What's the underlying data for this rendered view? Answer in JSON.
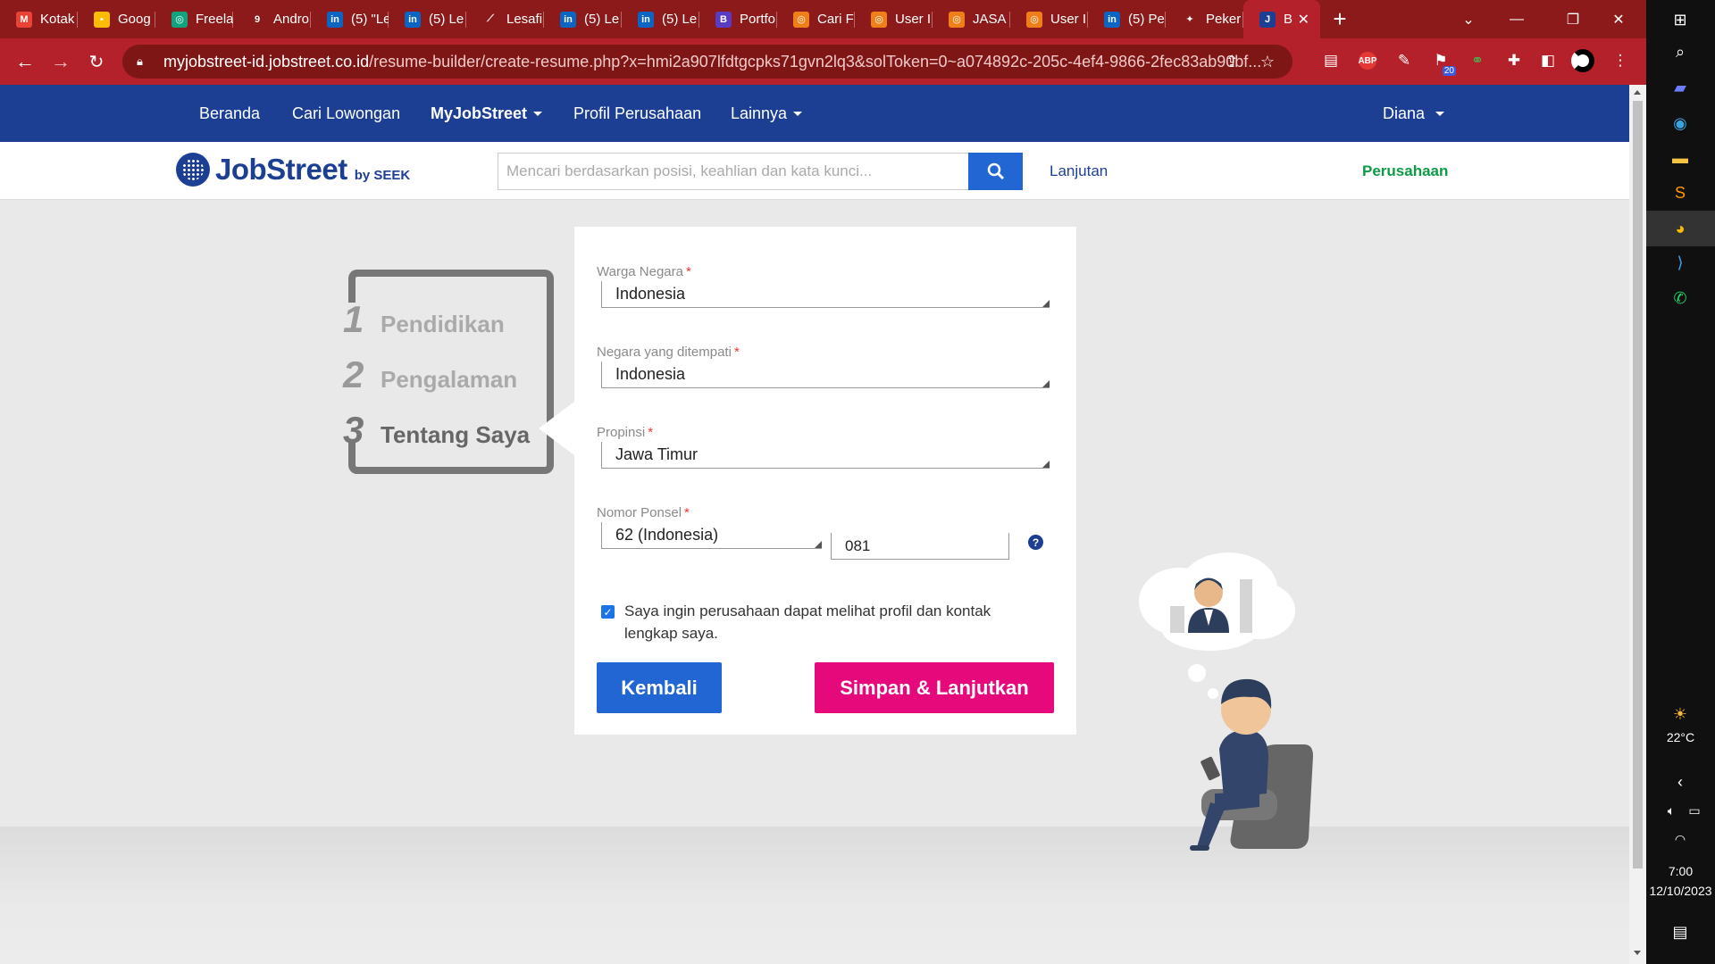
{
  "browser": {
    "tabs": [
      {
        "title": "Kotak",
        "icon": "gmail-icon",
        "color": "#ea4335",
        "glyph": "M"
      },
      {
        "title": "Goog",
        "icon": "google-keep-icon",
        "color": "#fbbc04",
        "glyph": "▪"
      },
      {
        "title": "Freela",
        "icon": "chatgpt-icon",
        "color": "#10a37f",
        "glyph": "◎"
      },
      {
        "title": "Andro",
        "icon": "g-icon",
        "color": "#8c1a1a",
        "glyph": "9"
      },
      {
        "title": "(5) \"Le",
        "icon": "linkedin-icon",
        "color": "#0a66c2",
        "glyph": "in"
      },
      {
        "title": "(5) Le",
        "icon": "linkedin-icon",
        "color": "#0a66c2",
        "glyph": "in"
      },
      {
        "title": "Lesafi",
        "icon": "chart-icon",
        "color": "#8c1a1a",
        "glyph": "⟋"
      },
      {
        "title": "(5) Le",
        "icon": "linkedin-icon",
        "color": "#0a66c2",
        "glyph": "in"
      },
      {
        "title": "(5) Le",
        "icon": "linkedin-icon",
        "color": "#0a66c2",
        "glyph": "in"
      },
      {
        "title": "Portfo",
        "icon": "behance-icon",
        "color": "#5a3cc4",
        "glyph": "B"
      },
      {
        "title": "Cari F",
        "icon": "freelancer-icon",
        "color": "#f07f1a",
        "glyph": "◎"
      },
      {
        "title": "User I",
        "icon": "freelancer-icon",
        "color": "#f07f1a",
        "glyph": "◎"
      },
      {
        "title": "JASA",
        "icon": "freelancer-icon",
        "color": "#f07f1a",
        "glyph": "◎"
      },
      {
        "title": "User I",
        "icon": "freelancer-icon",
        "color": "#f07f1a",
        "glyph": "◎"
      },
      {
        "title": "(5) Pe",
        "icon": "linkedin-icon",
        "color": "#0a66c2",
        "glyph": "in"
      },
      {
        "title": "Peker",
        "icon": "star-icon",
        "color": "#8c1a1a",
        "glyph": "✦"
      },
      {
        "title": "B",
        "icon": "jobstreet-icon",
        "color": "#1c3f94",
        "glyph": "J",
        "active": true
      }
    ],
    "url_host": "myjobstreet-id.jobstreet.co.id",
    "url_path": "/resume-builder/create-resume.php?x=hmi2a907lfdtgcpks71gvn2lq3&solToken=0~a074892c-205c-4ef4-9866-2fec83ab90bf...",
    "extension_badge": "20"
  },
  "sitenav": {
    "beranda": "Beranda",
    "cari_lowongan": "Cari Lowongan",
    "myjobstreet": "MyJobStreet",
    "profil_perusahaan": "Profil Perusahaan",
    "lainnya": "Lainnya",
    "user": "Diana"
  },
  "header": {
    "logo_text": "JobStreet",
    "logo_by": "by SEEK",
    "search_placeholder": "Mencari berdasarkan posisi, keahlian dan kata kunci...",
    "lanjutan": "Lanjutan",
    "perusahaan": "Perusahaan"
  },
  "steps": [
    {
      "num": "1",
      "label": "Pendidikan"
    },
    {
      "num": "2",
      "label": "Pengalaman"
    },
    {
      "num": "3",
      "label": "Tentang Saya"
    }
  ],
  "form": {
    "warga_negara_label": "Warga Negara",
    "warga_negara_value": "Indonesia",
    "negara_label": "Negara yang ditempati",
    "negara_value": "Indonesia",
    "propinsi_label": "Propinsi",
    "propinsi_value": "Jawa Timur",
    "ponsel_label": "Nomor Ponsel",
    "ponsel_code": "62 (Indonesia)",
    "ponsel_number": "081",
    "required_mark": "*",
    "help_glyph": "?",
    "consent_text": "Saya ingin perusahaan dapat melihat profil dan kontak lengkap saya.",
    "consent_checked": true,
    "back_button": "Kembali",
    "save_button": "Simpan & Lanjutkan"
  },
  "taskbar": {
    "temperature": "22°C",
    "time": "7:00",
    "date": "12/10/2023"
  },
  "colors": {
    "brand_blue": "#1c3f94",
    "button_blue": "#2166d2",
    "button_pink": "#e6097c",
    "green": "#0c9c46",
    "chrome_red": "#b5212b"
  }
}
